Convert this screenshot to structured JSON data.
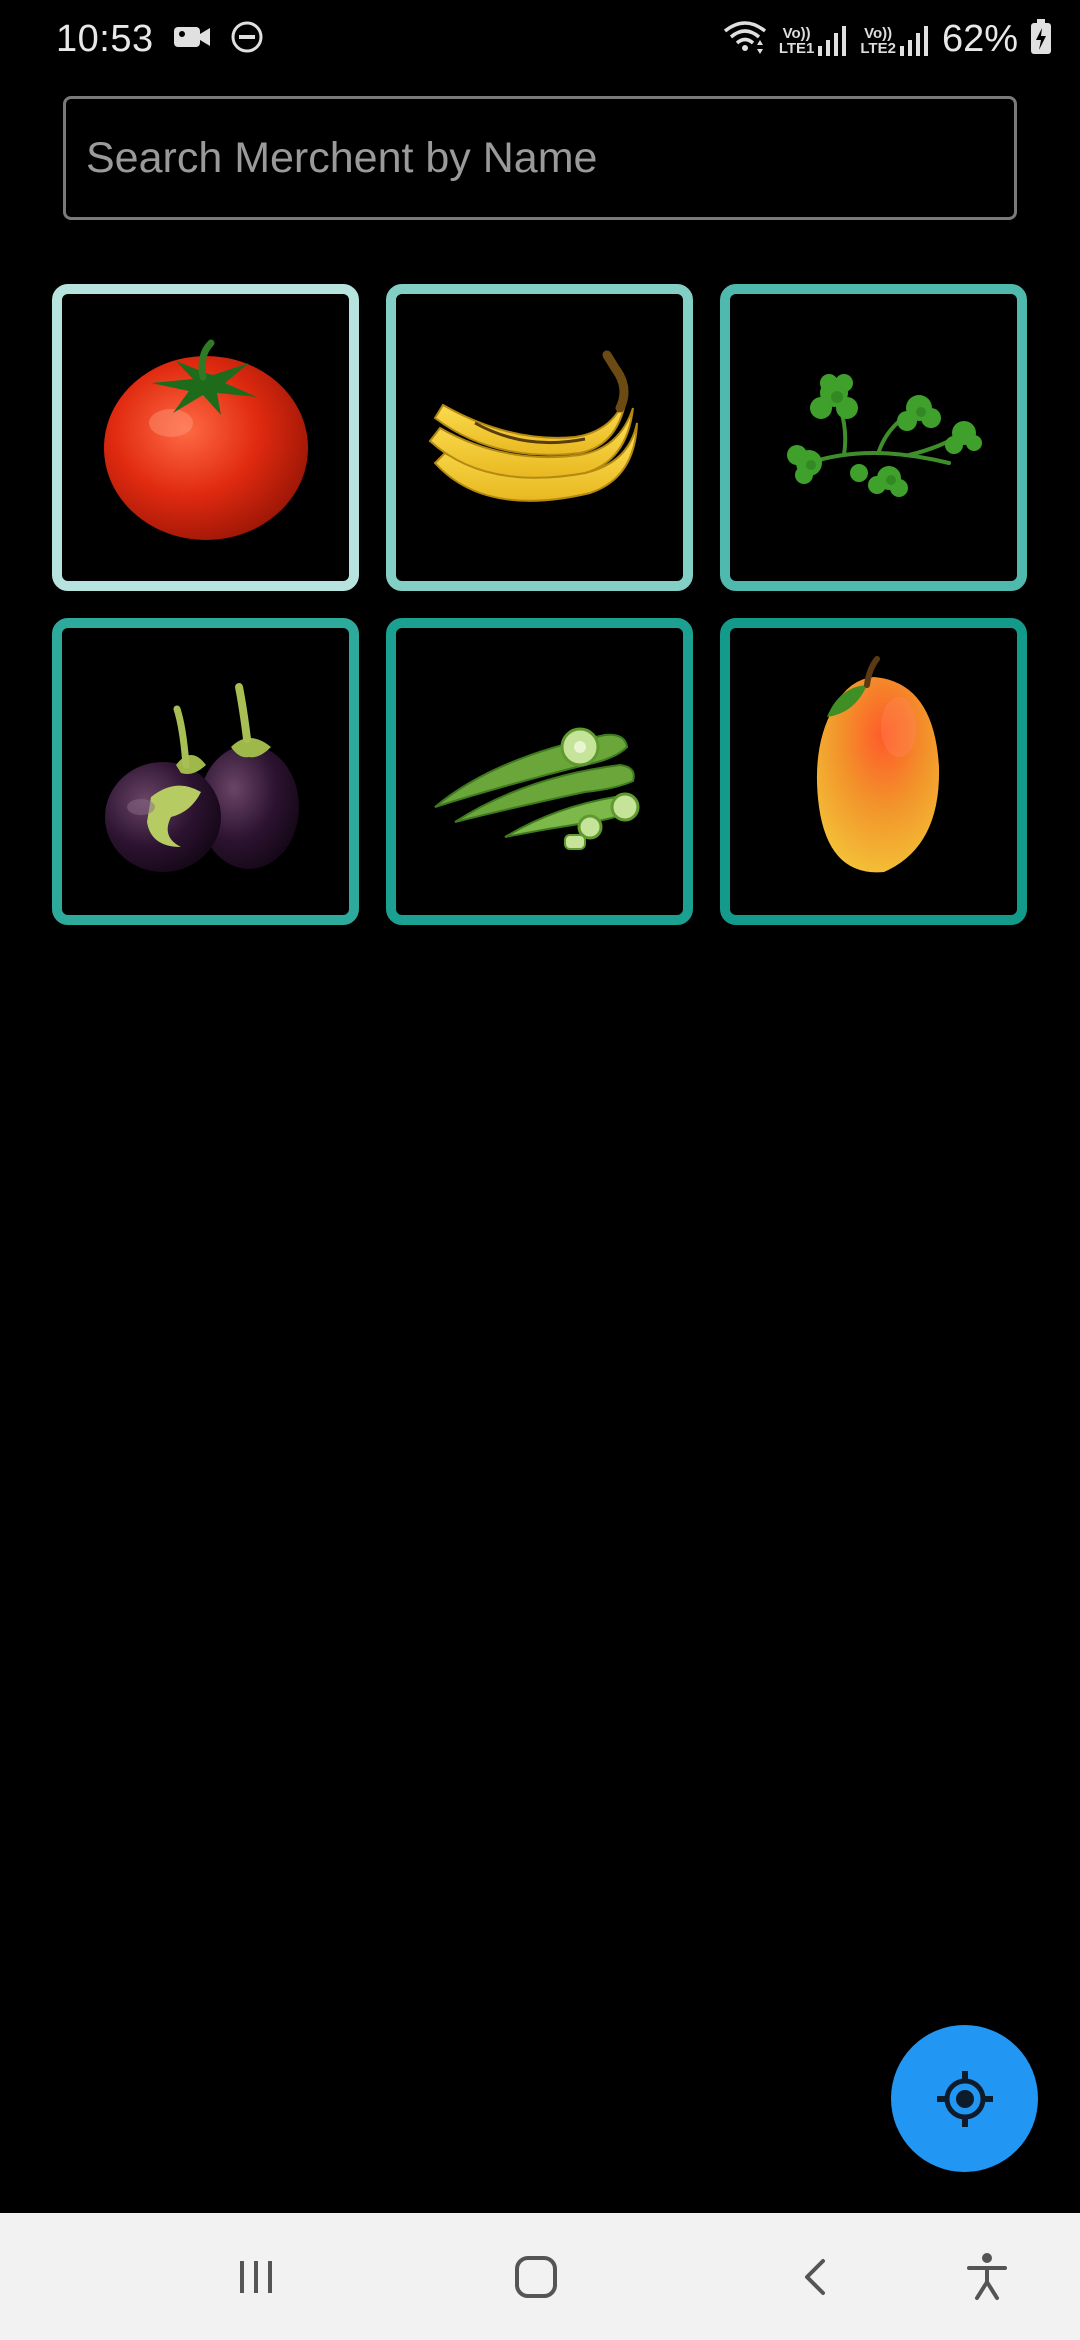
{
  "status_bar": {
    "time": "10:53",
    "battery_percent": "62%",
    "sim1_label_top": "Vo))",
    "sim1_label_bottom": "LTE1",
    "sim2_label_top": "Vo))",
    "sim2_label_bottom": "LTE2",
    "icons": [
      "video-camera-icon",
      "do-not-disturb-icon",
      "wifi-icon",
      "signal-icon",
      "battery-charging-icon"
    ]
  },
  "search": {
    "placeholder": "Search Merchent by Name",
    "value": ""
  },
  "categories": [
    {
      "icon": "tomato-icon",
      "border_color": "#b6e3de"
    },
    {
      "icon": "banana-icon",
      "border_color": "#83cfc6"
    },
    {
      "icon": "parsley-icon",
      "border_color": "#4fb9ad"
    },
    {
      "icon": "eggplant-icon",
      "border_color": "#2eaa9c"
    },
    {
      "icon": "okra-icon",
      "border_color": "#1ba091"
    },
    {
      "icon": "mango-icon",
      "border_color": "#139a8b"
    }
  ],
  "fab": {
    "icon": "location-target-icon",
    "color": "#2196f3"
  },
  "nav_bar": {
    "icons": [
      "recent-apps-icon",
      "home-icon",
      "back-icon",
      "accessibility-icon"
    ]
  },
  "colors": {
    "background": "#000000",
    "accent": "#2196f3",
    "tile_border": "#2aa79b"
  }
}
